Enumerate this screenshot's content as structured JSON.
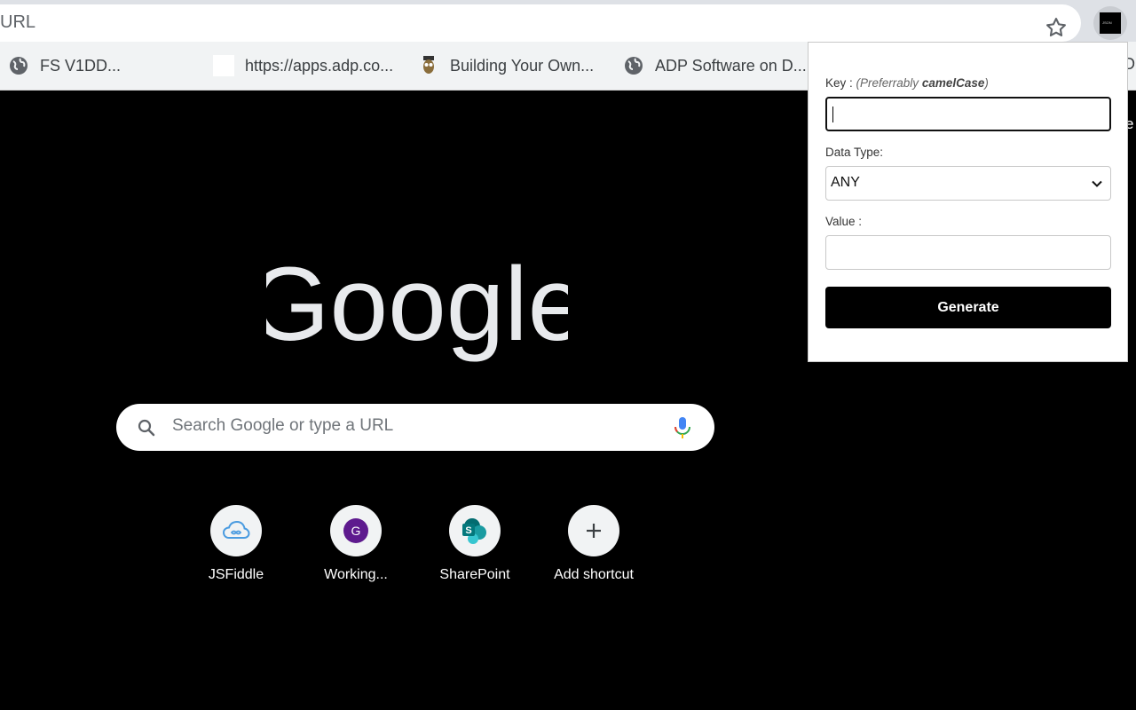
{
  "browser": {
    "url_text": "URL",
    "ext_icon_text": "JSON"
  },
  "bookmarks": [
    {
      "label": "FS V1DD...",
      "icon": "globe-icon"
    },
    {
      "label": "https://apps.adp.co...",
      "icon": "blank-page-icon"
    },
    {
      "label": "Building Your Own...",
      "icon": "owl-icon"
    },
    {
      "label": "ADP Software on D...",
      "icon": "globe-icon"
    }
  ],
  "bookmarks_edge_text": "D",
  "newtab": {
    "logo_text": "Google",
    "search_placeholder": "Search Google or type a URL",
    "side_fragment": "e",
    "shortcuts": [
      {
        "label": "JSFiddle",
        "icon": "jsfiddle-icon"
      },
      {
        "label": "Working...",
        "icon": "letter-g-icon",
        "letter": "G"
      },
      {
        "label": "SharePoint",
        "icon": "sharepoint-icon",
        "letter": "S"
      },
      {
        "label": "Add shortcut",
        "icon": "plus-icon"
      }
    ]
  },
  "popup": {
    "key_label": "Key :",
    "key_hint_open": "(Preferrably ",
    "key_hint_bold": "camelCase",
    "key_hint_close": ")",
    "key_value": "",
    "datatype_label": "Data Type:",
    "datatype_selected": "ANY",
    "value_label": "Value :",
    "value_value": "",
    "generate_label": "Generate"
  },
  "colors": {
    "page_bg": "#000000",
    "toolbar_bg": "#dee1e6",
    "bookmark_bar_bg": "#f1f3f4",
    "button_bg": "#000000"
  }
}
